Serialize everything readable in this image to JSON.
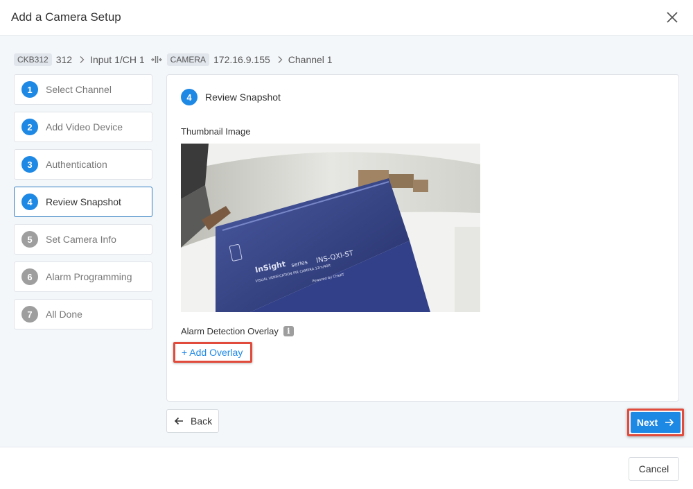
{
  "dialog": {
    "title": "Add a Camera Setup",
    "close_icon": "close-icon"
  },
  "breadcrumb": {
    "device_tag": "CKB312",
    "device_id": "312",
    "input": "Input 1/CH 1",
    "camera_tag": "CAMERA",
    "camera_ip": "172.16.9.155",
    "channel": "Channel 1"
  },
  "steps": [
    {
      "num": "1",
      "label": "Select Channel",
      "state": "done"
    },
    {
      "num": "2",
      "label": "Add Video Device",
      "state": "done"
    },
    {
      "num": "3",
      "label": "Authentication",
      "state": "done"
    },
    {
      "num": "4",
      "label": "Review Snapshot",
      "state": "active"
    },
    {
      "num": "5",
      "label": "Set Camera Info",
      "state": "pending"
    },
    {
      "num": "6",
      "label": "Alarm Programming",
      "state": "pending"
    },
    {
      "num": "7",
      "label": "All Done",
      "state": "pending"
    }
  ],
  "panel": {
    "step_num": "4",
    "title": "Review Snapshot",
    "thumbnail_label": "Thumbnail Image",
    "overlay_label": "Alarm Detection Overlay",
    "add_overlay": "+ Add Overlay",
    "snapshot_text": {
      "brand": "InSight",
      "series": "series",
      "model": "INS-QXI-ST",
      "line2": "VISUAL VERIFICATION PIR CAMERA  12m/40ft",
      "line3": "Powered by CHeKT"
    }
  },
  "nav": {
    "back": "Back",
    "next": "Next"
  },
  "footer": {
    "cancel": "Cancel"
  },
  "colors": {
    "accent": "#1e88e5",
    "highlight": "#e14b3b",
    "pending": "#9e9e9e"
  }
}
